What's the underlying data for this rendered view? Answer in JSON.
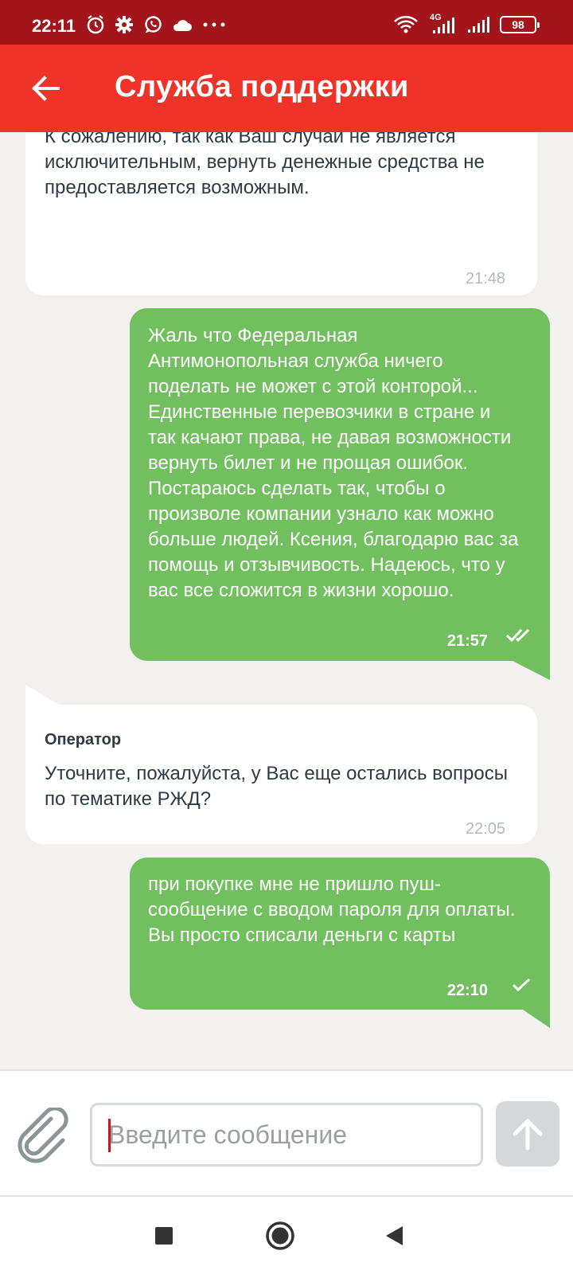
{
  "status_bar": {
    "time": "22:11",
    "network": "4G",
    "battery": "98",
    "icons": [
      "alarm-icon",
      "gear-icon",
      "whatsapp-icon",
      "cloud-icon",
      "more-dots-icon",
      "wifi-icon",
      "signal-4g-icon",
      "signal-icon",
      "battery-icon"
    ]
  },
  "header": {
    "title": "Служба поддержки",
    "back_icon": "arrow-left-icon",
    "background": "#ee3428"
  },
  "messages": [
    {
      "from": "operator",
      "text": "Сбор за возврат не взимается, если его размер превышает или равен стоимости сервисных услуг или белья.\nК сожалению, так как Ваш случай не является исключительным, вернуть денежные средства не предоставляется возможным.",
      "time": "21:48"
    },
    {
      "from": "user",
      "text": "Жаль что Федеральная Антимонопольная служба ничего поделать не может с этой конторой... Единственные перевозчики в стране и так качают права, не давая возможности вернуть билет и не прощая ошибок. Постараюсь сделать так, чтобы о произволе компании узнало как можно больше людей. Ксения, благодарю вас за помощь и отзывчивость. Надеюсь, что у вас все сложится в жизни хорошо.",
      "time": "21:57",
      "status": "read"
    },
    {
      "from": "operator",
      "sender": "Оператор",
      "text": "Уточните, пожалуйста, у Вас еще остались вопросы по тематике РЖД?",
      "time": "22:05"
    },
    {
      "from": "user",
      "text": "при покупке мне не пришло пуш-сообщение с вводом пароля для оплаты. Вы просто списали деньги с карты",
      "time": "22:10",
      "status": "sent"
    }
  ],
  "composer": {
    "placeholder": "Введите сообщение",
    "value": "",
    "attach_icon": "paperclip-icon",
    "send_icon": "arrow-up-icon"
  },
  "colors": {
    "status_bar": "#a3151b",
    "accent": "#ee3428",
    "user_bubble": "#71bf5e",
    "operator_bubble": "#ffffff",
    "chat_background": "#f2f1ef",
    "text": "#2c3b45"
  },
  "nav_bar": {
    "icons": [
      "square-recents-icon",
      "circle-home-icon",
      "triangle-back-icon"
    ]
  }
}
